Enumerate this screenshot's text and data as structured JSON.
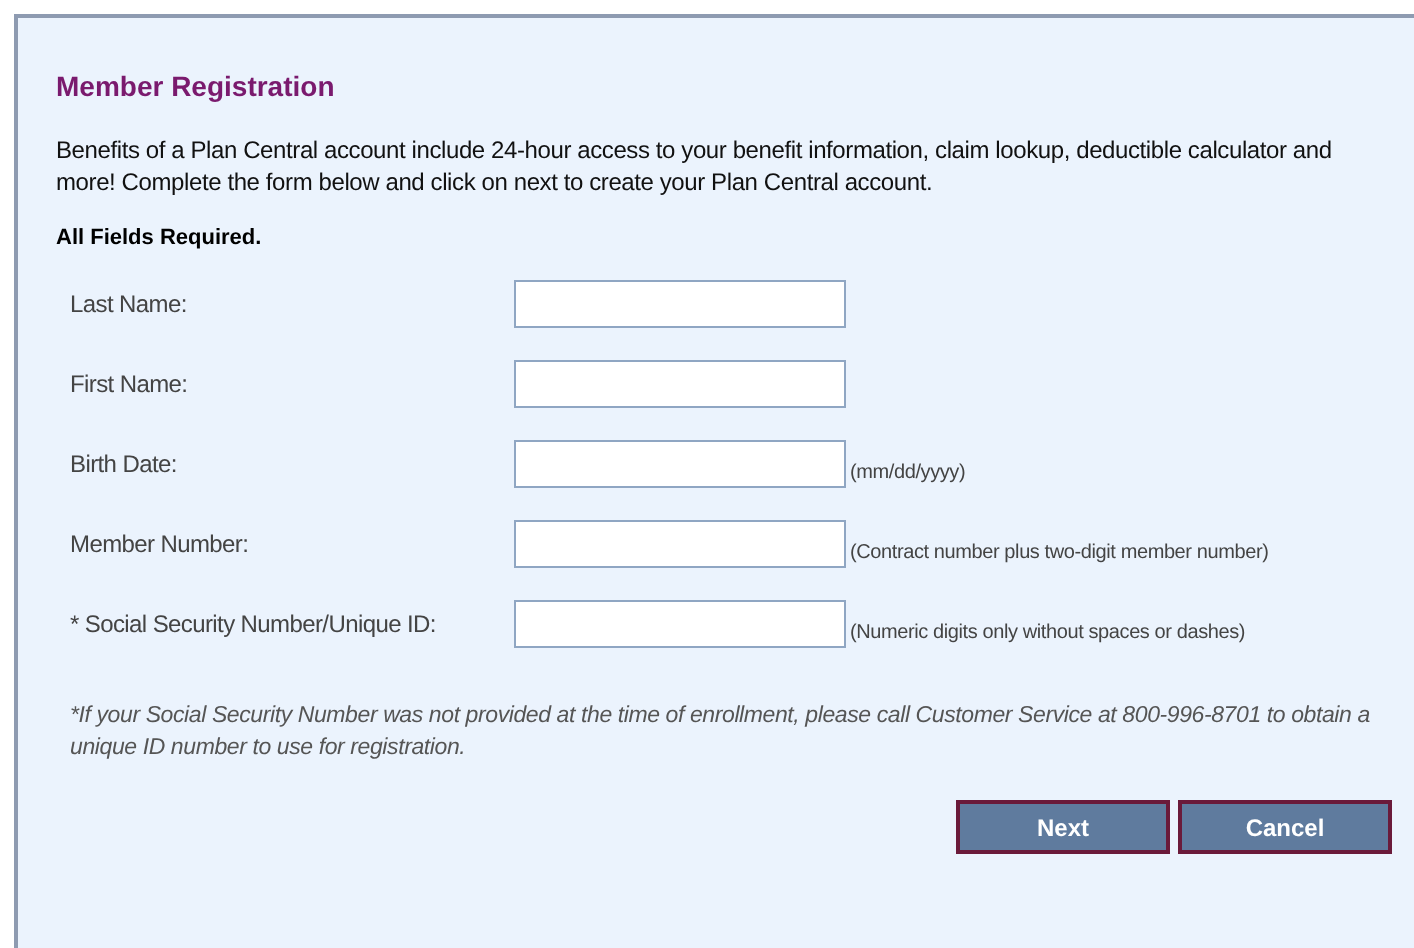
{
  "title": "Member Registration",
  "intro": "Benefits of a Plan Central account include 24-hour access to your benefit information, claim lookup, deductible calculator and more! Complete the form below and click on next to create your Plan Central account.",
  "required_note": "All Fields Required.",
  "fields": [
    {
      "label": "Last Name:"
    },
    {
      "label": "First Name:"
    },
    {
      "label": "Birth Date:",
      "hint": "(mm/dd/yyyy)"
    },
    {
      "label": "Member Number:",
      "hint": "(Contract number plus two-digit member number)"
    },
    {
      "label": "* Social Security Number/Unique ID:",
      "hint": "(Numeric digits only without spaces or dashes)"
    }
  ],
  "footnote": "*If your Social Security Number was not provided at the time of enrollment, please call Customer Service at 800-996-8701 to obtain a unique ID number to use for registration.",
  "buttons": [
    "Next",
    "Cancel"
  ]
}
